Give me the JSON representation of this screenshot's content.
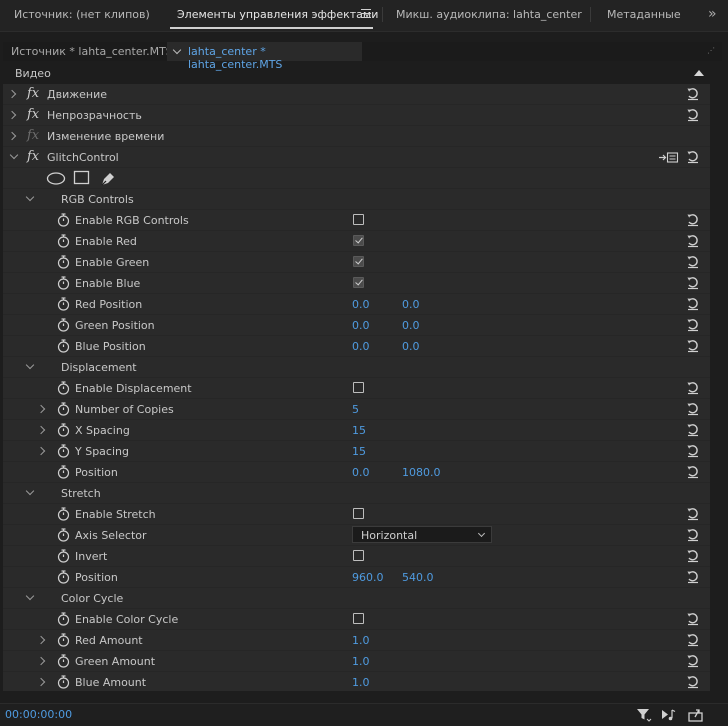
{
  "tabs": [
    {
      "label": "Источник: (нет клипов)",
      "active": false
    },
    {
      "label": "Элементы управления эффектами",
      "active": true
    },
    {
      "label": "Микш. аудиоклипа: lahta_center",
      "active": false
    },
    {
      "label": "Метаданные",
      "active": false
    }
  ],
  "tab_overflow": "»",
  "clip_selector": {
    "source": "Источник * lahta_center.MTS",
    "target": "lahta_center * lahta_center.MTS"
  },
  "section": {
    "label": "Видео"
  },
  "effects": [
    {
      "label": "Движение"
    },
    {
      "label": "Непрозрачность"
    },
    {
      "label": "Изменение времени"
    },
    {
      "label": "GlitchControl"
    }
  ],
  "groups": {
    "rgb": {
      "label": "RGB Controls",
      "enable_rgb": "Enable RGB Controls",
      "enable_red": "Enable Red",
      "enable_green": "Enable Green",
      "enable_blue": "Enable Blue",
      "red_position": {
        "label": "Red Position",
        "x": "0.0",
        "y": "0.0"
      },
      "green_position": {
        "label": "Green Position",
        "x": "0.0",
        "y": "0.0"
      },
      "blue_position": {
        "label": "Blue Position",
        "x": "0.0",
        "y": "0.0"
      }
    },
    "displacement": {
      "label": "Displacement",
      "enable": "Enable Displacement",
      "copies": {
        "label": "Number of Copies",
        "value": "5"
      },
      "x_spacing": {
        "label": "X Spacing",
        "value": "15"
      },
      "y_spacing": {
        "label": "Y Spacing",
        "value": "15"
      },
      "position": {
        "label": "Position",
        "x": "0.0",
        "y": "1080.0"
      }
    },
    "stretch": {
      "label": "Stretch",
      "enable": "Enable Stretch",
      "axis": {
        "label": "Axis Selector",
        "value": "Horizontal"
      },
      "invert": "Invert",
      "position": {
        "label": "Position",
        "x": "960.0",
        "y": "540.0"
      }
    },
    "color_cycle": {
      "label": "Color Cycle",
      "enable": "Enable Color Cycle",
      "red_amount": {
        "label": "Red Amount",
        "value": "1.0"
      },
      "green_amount": {
        "label": "Green Amount",
        "value": "1.0"
      },
      "blue_amount": {
        "label": "Blue Amount",
        "value": "1.0"
      }
    }
  },
  "checkbox_state": {
    "enable_rgb": false,
    "enable_red": true,
    "enable_green": true,
    "enable_blue": true,
    "enable_displacement": false,
    "enable_stretch": false,
    "invert": false,
    "enable_color_cycle": false
  },
  "timecode": "00:00:00:00",
  "colors": {
    "accent_value": "#4f9be0",
    "background": "#1d1d1d",
    "header_row": "#2a2a2a"
  }
}
